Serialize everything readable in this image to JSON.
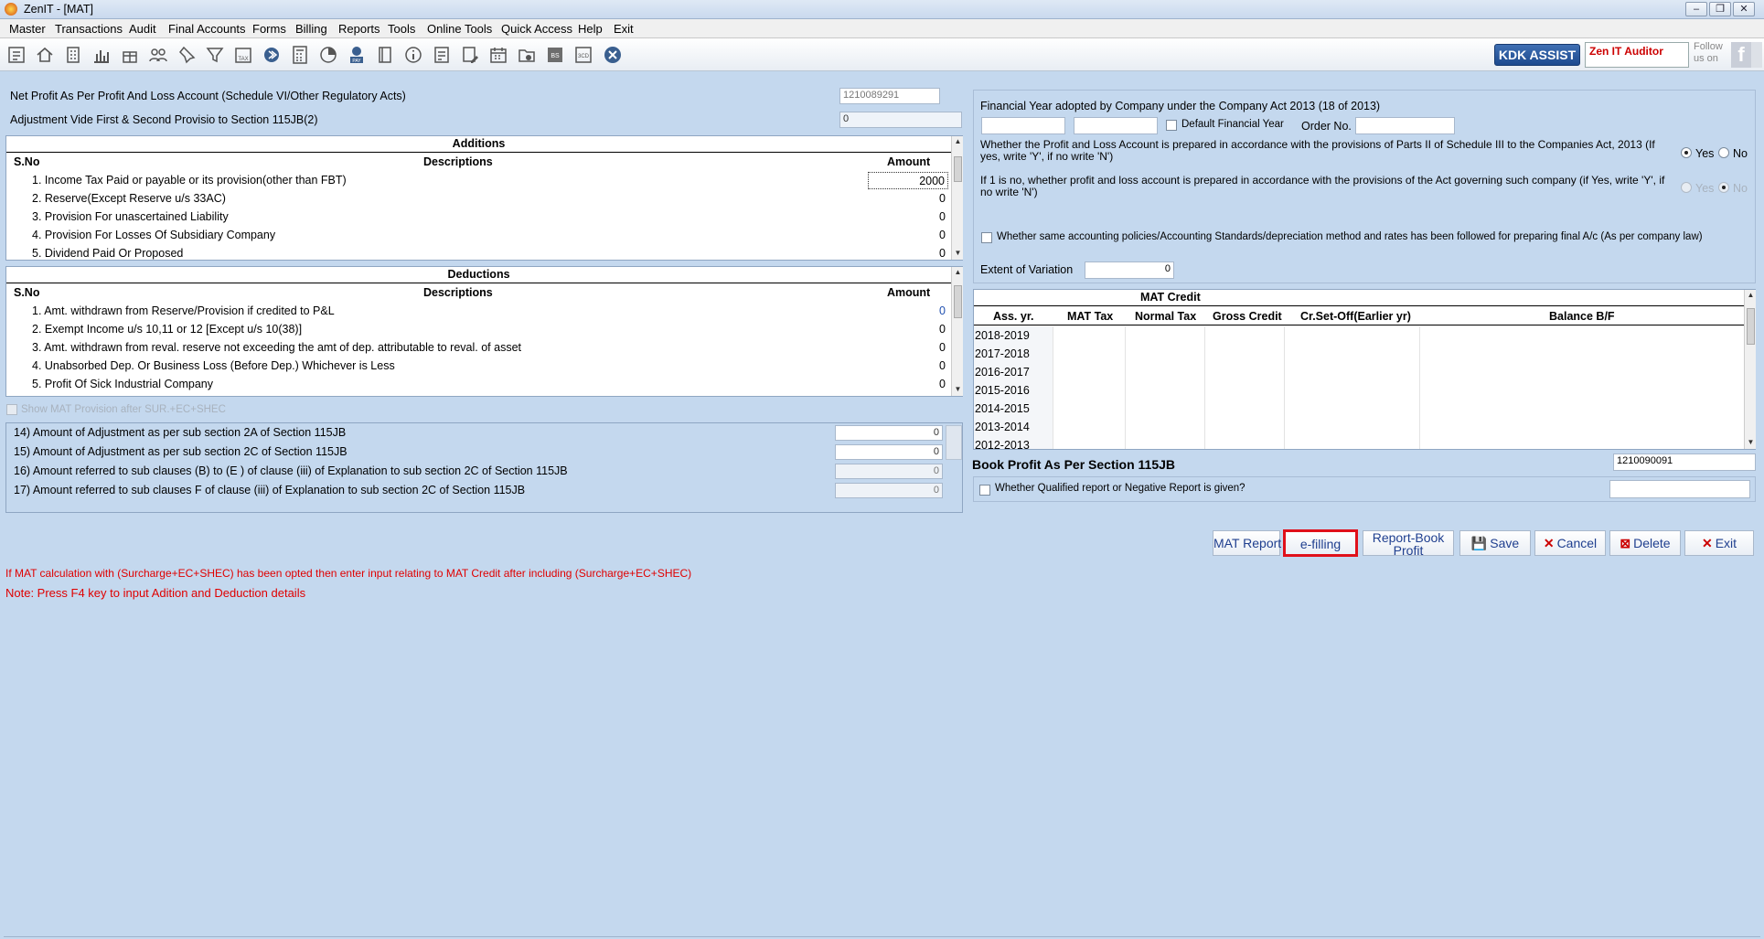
{
  "window": {
    "title": "ZenIT - [MAT]"
  },
  "menu": [
    "Master",
    "Transactions",
    "Audit",
    "Final Accounts",
    "Forms",
    "Billing",
    "Reports",
    "Tools",
    "Online Tools",
    "Quick Access",
    "Help",
    "Exit"
  ],
  "toolbar_icons": [
    "report-icon",
    "home-icon",
    "building-icon",
    "bar-chart-icon",
    "gift-icon",
    "users-icon",
    "pin-icon",
    "filter-icon",
    "tax-icon",
    "forward-icon",
    "calculator-icon",
    "pie-icon",
    "pay-icon",
    "book-icon",
    "info-icon",
    "document-icon",
    "edit-document-icon",
    "calendar-icon",
    "lock-folder-icon",
    "bs-icon",
    "3cd-icon",
    "close-circle-icon"
  ],
  "branding": {
    "kdk": "KDK ASSIST",
    "zen": "Zen IT Auditor",
    "follow": "Follow us on",
    "fb": "f"
  },
  "top": {
    "net_profit_label": "Net Profit As Per Profit And Loss Account (Schedule VI/Other Regulatory Acts)",
    "net_profit_value": "1210089291",
    "adjustment_label": "Adjustment Vide First & Second Provisio to Section 115JB(2)",
    "adjustment_value": "0"
  },
  "additions": {
    "title": "Additions",
    "col_sno": "S.No",
    "col_desc": "Descriptions",
    "col_amt": "Amount",
    "rows": [
      {
        "text": "1.  Income Tax Paid or payable or its provision(other than FBT)",
        "amount": "2000"
      },
      {
        "text": "2.  Reserve(Except Reserve u/s 33AC)",
        "amount": "0"
      },
      {
        "text": "3.  Provision For unascertained Liability",
        "amount": "0"
      },
      {
        "text": "4.  Provision For Losses Of Subsidiary Company",
        "amount": "0"
      },
      {
        "text": "5.  Dividend Paid Or Proposed",
        "amount": "0"
      }
    ]
  },
  "deductions": {
    "title": "Deductions",
    "col_sno": "S.No",
    "col_desc": "Descriptions",
    "col_amt": "Amount",
    "rows": [
      {
        "text": "1.  Amt. withdrawn from Reserve/Provision if credited to P&L",
        "amount": "0"
      },
      {
        "text": "2.  Exempt Income u/s 10,11 or 12 [Except u/s 10(38)]",
        "amount": "0"
      },
      {
        "text": "3.  Amt. withdrawn from reval. reserve not exceeding the amt of dep. attributable to reval. of asset",
        "amount": "0"
      },
      {
        "text": "4.  Unabsorbed Dep. Or Business Loss (Before Dep.) Whichever is Less",
        "amount": "0"
      },
      {
        "text": "5.  Profit Of Sick Industrial Company",
        "amount": "0"
      }
    ]
  },
  "show_mat": "Show MAT Provision after SUR.+EC+SHEC",
  "adjustments": [
    {
      "text": "14)  Amount of Adjustment as per sub section 2A of Section 115JB",
      "value": "0"
    },
    {
      "text": "15) Amount of Adjustment as per sub section 2C of Section 115JB",
      "value": "0"
    },
    {
      "text": "16) Amount referred to sub clauses (B) to (E ) of clause (iii) of Explanation to sub section 2C of Section 115JB",
      "value": "0"
    },
    {
      "text": "17) Amount referred to sub clauses F of clause (iii) of Explanation to sub section 2C of Section 115JB",
      "value": "0"
    }
  ],
  "right": {
    "fy_label": "Financial Year adopted by Company under the Company Act 2013 (18 of 2013)",
    "default_fy": "Default Financial Year",
    "order_no": "Order No.",
    "q1": "Whether the Profit and Loss Account is prepared in accordance with the provisions of Parts II of Schedule III to the Companies Act, 2013 (If yes, write 'Y', if no write 'N')",
    "q2": "If 1 is no, whether profit and loss account is prepared in accordance with the provisions of the Act governing such company (if Yes, write 'Y', if no write 'N')",
    "yes": "Yes",
    "no": "No",
    "q3": "Whether same accounting policies/Accounting Standards/depreciation method and  rates has been followed for preparing final A/c (As per company law)",
    "variation_label": "Extent of Variation",
    "variation_value": "0"
  },
  "mat_credit": {
    "title": "MAT Credit",
    "headers": [
      "Ass. yr.",
      "MAT Tax",
      "Normal Tax",
      "Gross Credit",
      "Cr.Set-Off(Earlier yr)",
      "Balance B/F"
    ],
    "years": [
      "2018-2019",
      "2017-2018",
      "2016-2017",
      "2015-2016",
      "2014-2015",
      "2013-2014",
      "2012-2013"
    ]
  },
  "book_profit": {
    "label": "Book Profit As Per Section 115JB",
    "value": "1210090091"
  },
  "qualified_report": "Whether Qualified report or Negative Report is given?",
  "buttons": {
    "mat_report": "MAT Report",
    "efilling": "e-filling",
    "report_book_1": "Report-Book",
    "report_book_2": "Profit",
    "save": "Save",
    "cancel": "Cancel",
    "delete": "Delete",
    "exit": "Exit"
  },
  "notes": {
    "n1": "If MAT calculation with (Surcharge+EC+SHEC) has been opted then enter input relating to MAT Credit after including (Surcharge+EC+SHEC)",
    "n2": "Note: Press F4 key to input Adition and Deduction details"
  },
  "colors": {
    "background": "#c4d8ee",
    "highlight": "#e0101a",
    "note": "#e00000"
  }
}
